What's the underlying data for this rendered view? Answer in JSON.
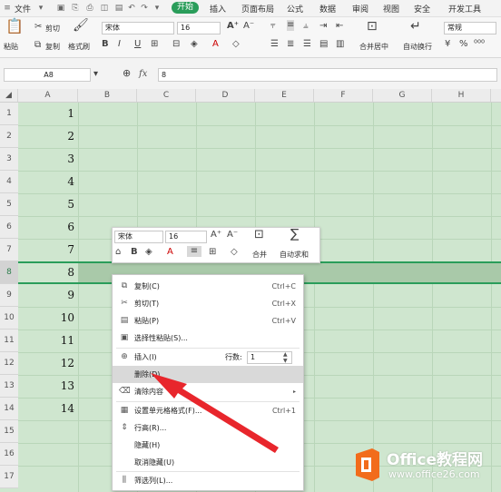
{
  "menu": {
    "file": "文件",
    "tabs": [
      "开始",
      "插入",
      "页面布局",
      "公式",
      "数据",
      "审阅",
      "视图",
      "安全",
      "开发工具"
    ],
    "active_tab": "开始"
  },
  "ribbon": {
    "paste": "粘贴",
    "cut": "剪切",
    "copy": "复制",
    "format_painter": "格式刷",
    "font_name": "宋体",
    "font_size": "16",
    "merge": "合并居中",
    "wrap": "自动换行",
    "number_format": "常规"
  },
  "formula_bar": {
    "name_box": "A8",
    "fx": "fx",
    "value": "8"
  },
  "grid": {
    "columns": [
      "A",
      "B",
      "C",
      "D",
      "E",
      "F",
      "G",
      "H"
    ],
    "rows": [
      "1",
      "2",
      "3",
      "4",
      "5",
      "6",
      "7",
      "8",
      "9",
      "10",
      "11",
      "12",
      "13",
      "14",
      "15",
      "16",
      "17"
    ],
    "values": [
      "1",
      "2",
      "3",
      "4",
      "5",
      "6",
      "7",
      "8",
      "9",
      "10",
      "11",
      "12",
      "13",
      "14"
    ]
  },
  "mini_toolbar": {
    "font_name": "宋体",
    "font_size": "16",
    "bold": "B",
    "merge": "合并",
    "autosum": "自动求和"
  },
  "context_menu": {
    "items": [
      {
        "label": "复制(C)",
        "shortcut": "Ctrl+C"
      },
      {
        "label": "剪切(T)",
        "shortcut": "Ctrl+X"
      },
      {
        "label": "粘贴(P)",
        "shortcut": "Ctrl+V"
      },
      {
        "label": "选择性粘贴(S)...",
        "shortcut": ""
      },
      {
        "label": "插入(I)",
        "shortcut": ""
      },
      {
        "label": "删除(D)",
        "shortcut": ""
      },
      {
        "label": "清除内容",
        "shortcut": ""
      },
      {
        "label": "设置单元格格式(F)...",
        "shortcut": "Ctrl+1"
      },
      {
        "label": "行高(R)...",
        "shortcut": ""
      },
      {
        "label": "隐藏(H)",
        "shortcut": ""
      },
      {
        "label": "取消隐藏(U)",
        "shortcut": ""
      },
      {
        "label": "筛选列(L)...",
        "shortcut": ""
      }
    ],
    "row_count_label": "行数:",
    "row_count_value": "1"
  },
  "watermark": {
    "brand": "Office教程网",
    "url": "www.office26.com"
  },
  "colors": {
    "accent": "#2a9d5a",
    "grid_bg": "#cfe6cf",
    "selected_row": "#a9c9a9",
    "arrow": "#e8262c",
    "logo_orange": "#f26c1b"
  }
}
